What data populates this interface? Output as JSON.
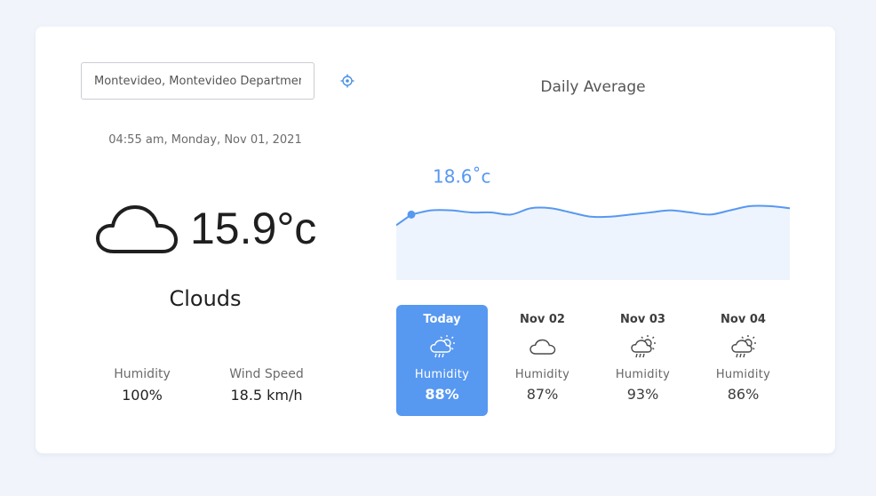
{
  "search": {
    "value": "Montevideo, Montevideo Department, Uruguay",
    "locate_icon": "locate-crosshair-icon"
  },
  "current": {
    "datetime": "04:55 am, Monday, Nov 01, 2021",
    "icon": "cloud-icon",
    "temperature": "15.9°c",
    "condition": "Clouds",
    "humidity_label": "Humidity",
    "humidity_value": "100%",
    "wind_label": "Wind Speed",
    "wind_value": "18.5 km/h"
  },
  "chart_data": {
    "type": "area",
    "title": "Daily Average",
    "annotation": "18.6˚c",
    "series": [
      {
        "values": [
          18.6,
          18.8,
          18.8,
          18.7,
          18.7,
          18.6,
          18.9,
          18.9,
          18.7,
          18.5,
          18.5,
          18.6,
          18.7,
          18.8,
          18.7,
          18.6,
          18.8,
          19.0,
          19.0,
          18.9
        ]
      }
    ],
    "ylim": [
      15.5,
      19.5
    ],
    "grid": false,
    "color": "#5798f1",
    "fill": "#eef4fd"
  },
  "forecast": {
    "days": [
      {
        "name": "Today",
        "icon": "rain-sun-cloud-icon",
        "label": "Humidity",
        "value": "88%"
      },
      {
        "name": "Nov 02",
        "icon": "cloud-icon",
        "label": "Humidity",
        "value": "87%"
      },
      {
        "name": "Nov 03",
        "icon": "rain-sun-cloud-icon",
        "label": "Humidity",
        "value": "93%"
      },
      {
        "name": "Nov 04",
        "icon": "rain-sun-cloud-icon",
        "label": "Humidity",
        "value": "86%"
      }
    ]
  },
  "colors": {
    "accent": "#5798f1",
    "background": "#f1f5fb"
  }
}
